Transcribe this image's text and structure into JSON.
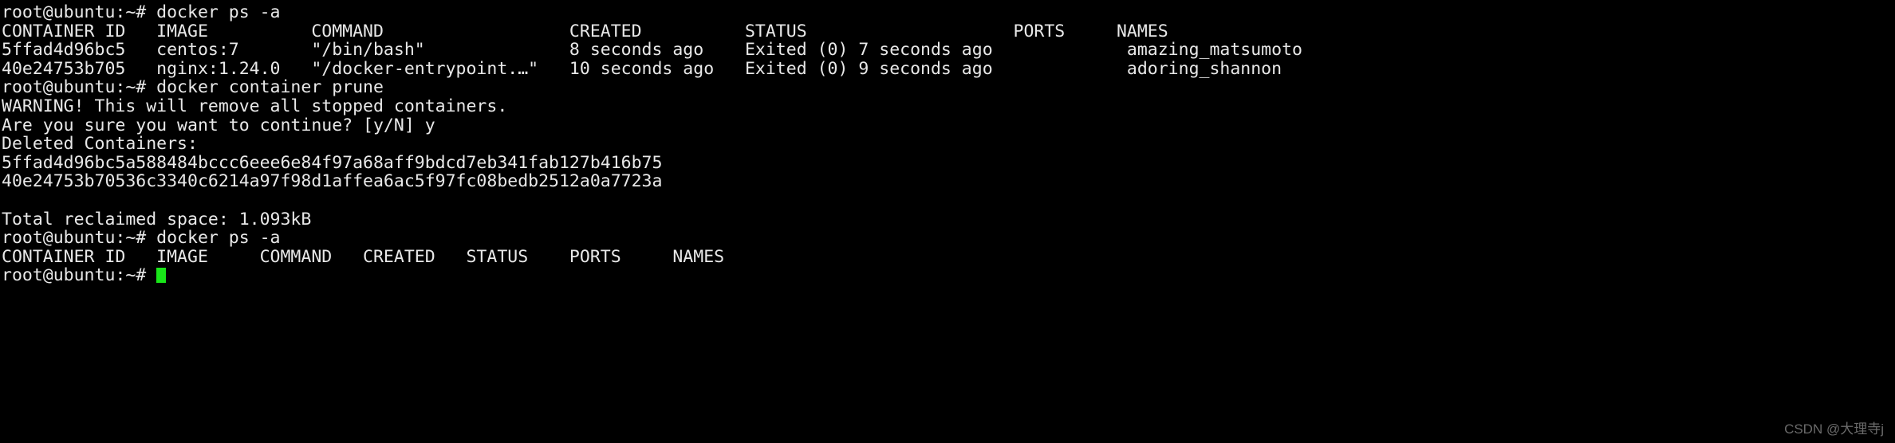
{
  "terminal": {
    "colors": {
      "background": "#000000",
      "foreground": "#e8e8e8",
      "cursor": "#19e619",
      "watermark": "#6a6a6a"
    },
    "prompt": "root@ubuntu:~#",
    "lines": [
      "root@ubuntu:~# docker ps -a",
      "CONTAINER ID   IMAGE          COMMAND                  CREATED          STATUS                    PORTS     NAMES",
      "5ffad4d96bc5   centos:7       \"/bin/bash\"              8 seconds ago    Exited (0) 7 seconds ago             amazing_matsumoto",
      "40e24753b705   nginx:1.24.0   \"/docker-entrypoint.…\"   10 seconds ago   Exited (0) 9 seconds ago             adoring_shannon",
      "root@ubuntu:~# docker container prune",
      "WARNING! This will remove all stopped containers.",
      "Are you sure you want to continue? [y/N] y",
      "Deleted Containers:",
      "5ffad4d96bc5a588484bccc6eee6e84f97a68aff9bdcd7eb341fab127b416b75",
      "40e24753b70536c3340c6214a97f98d1affea6ac5f97fc08bedb2512a0a7723a",
      "",
      "Total reclaimed space: 1.093kB",
      "root@ubuntu:~# docker ps -a",
      "CONTAINER ID   IMAGE     COMMAND   CREATED   STATUS    PORTS     NAMES"
    ],
    "last_line_prompt": "root@ubuntu:~# ",
    "commands": {
      "first": "docker ps -a",
      "second": "docker container prune",
      "third": "docker ps -a"
    },
    "ps_table_first": {
      "headers": [
        "CONTAINER ID",
        "IMAGE",
        "COMMAND",
        "CREATED",
        "STATUS",
        "PORTS",
        "NAMES"
      ],
      "rows": [
        {
          "container_id": "5ffad4d96bc5",
          "image": "centos:7",
          "command": "\"/bin/bash\"",
          "created": "8 seconds ago",
          "status": "Exited (0) 7 seconds ago",
          "ports": "",
          "names": "amazing_matsumoto"
        },
        {
          "container_id": "40e24753b705",
          "image": "nginx:1.24.0",
          "command": "\"/docker-entrypoint.…\"",
          "created": "10 seconds ago",
          "status": "Exited (0) 9 seconds ago",
          "ports": "",
          "names": "adoring_shannon"
        }
      ]
    },
    "prune_output": {
      "warning": "WARNING! This will remove all stopped containers.",
      "confirm_prompt": "Are you sure you want to continue? [y/N]",
      "confirm_answer": "y",
      "deleted_header": "Deleted Containers:",
      "deleted_ids": [
        "5ffad4d96bc5a588484bccc6eee6e84f97a68aff9bdcd7eb341fab127b416b75",
        "40e24753b70536c3340c6214a97f98d1affea6ac5f97fc08bedb2512a0a7723a"
      ],
      "reclaimed_label": "Total reclaimed space:",
      "reclaimed_value": "1.093kB"
    },
    "ps_table_second": {
      "headers": [
        "CONTAINER ID",
        "IMAGE",
        "COMMAND",
        "CREATED",
        "STATUS",
        "PORTS",
        "NAMES"
      ],
      "rows": []
    }
  },
  "watermark": {
    "text": "CSDN @大理寺j"
  }
}
